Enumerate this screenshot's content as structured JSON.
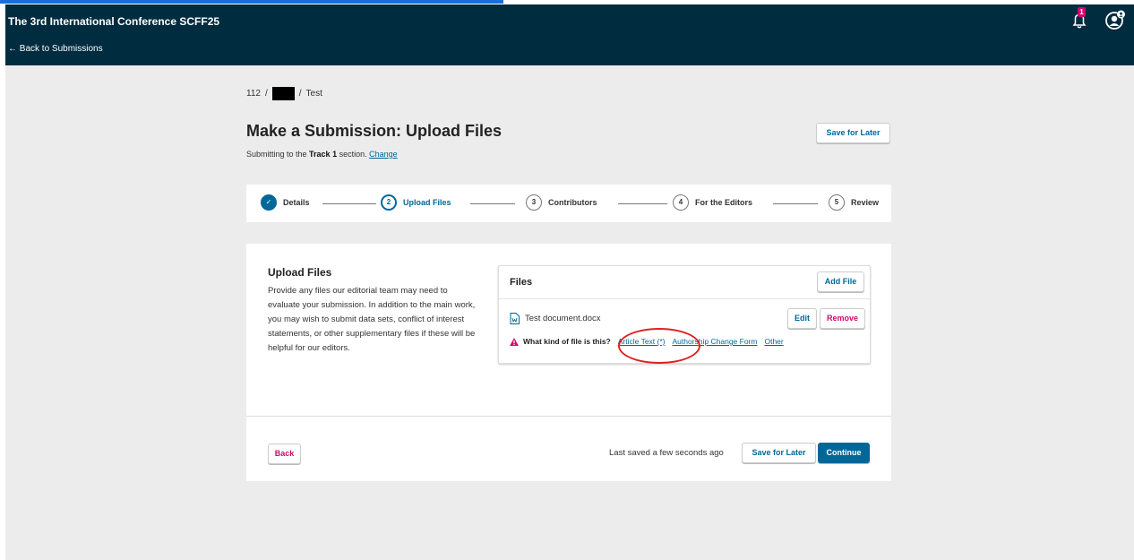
{
  "app": {
    "title": "The 3rd International Conference SCFF25",
    "back_label": "← Back to Submissions"
  },
  "notifications": {
    "count": "1"
  },
  "breadcrumb": {
    "id": "112",
    "sep1": "/",
    "sep2": "/",
    "last": "Test"
  },
  "page": {
    "title": "Make a Submission: Upload Files",
    "subtitle_pre": "Submitting to the ",
    "subtitle_section": "Track 1",
    "subtitle_post": " section. ",
    "change_link": "Change",
    "save_later_label": "Save for Later"
  },
  "steps": [
    {
      "number": "1",
      "label": "Details",
      "state": "done"
    },
    {
      "number": "2",
      "label": "Upload Files",
      "state": "current"
    },
    {
      "number": "3",
      "label": "Contributors",
      "state": "pending"
    },
    {
      "number": "4",
      "label": "For the Editors",
      "state": "pending"
    },
    {
      "number": "5",
      "label": "Review",
      "state": "pending"
    }
  ],
  "upload": {
    "heading": "Upload Files",
    "description": "Provide any files our editorial team may need to evaluate your submission. In addition to the main work, you may wish to submit data sets, conflict of interest statements, or other supplementary files if these will be helpful for our editors."
  },
  "files": {
    "title": "Files",
    "add_label": "Add File",
    "items": [
      {
        "name": "Test document.docx",
        "edit_label": "Edit",
        "remove_label": "Remove",
        "question": "What kind of file is this?",
        "options": [
          "Article Text (*)",
          "Authorship Change Form",
          "Other"
        ]
      }
    ]
  },
  "footer": {
    "back_label": "Back",
    "last_saved": "Last saved a few seconds ago",
    "save_later_label": "Save for Later",
    "continue_label": "Continue"
  },
  "colors": {
    "header_bg": "#002c40",
    "primary": "#006798",
    "danger": "#d00a6c",
    "callout": "#e02020"
  }
}
